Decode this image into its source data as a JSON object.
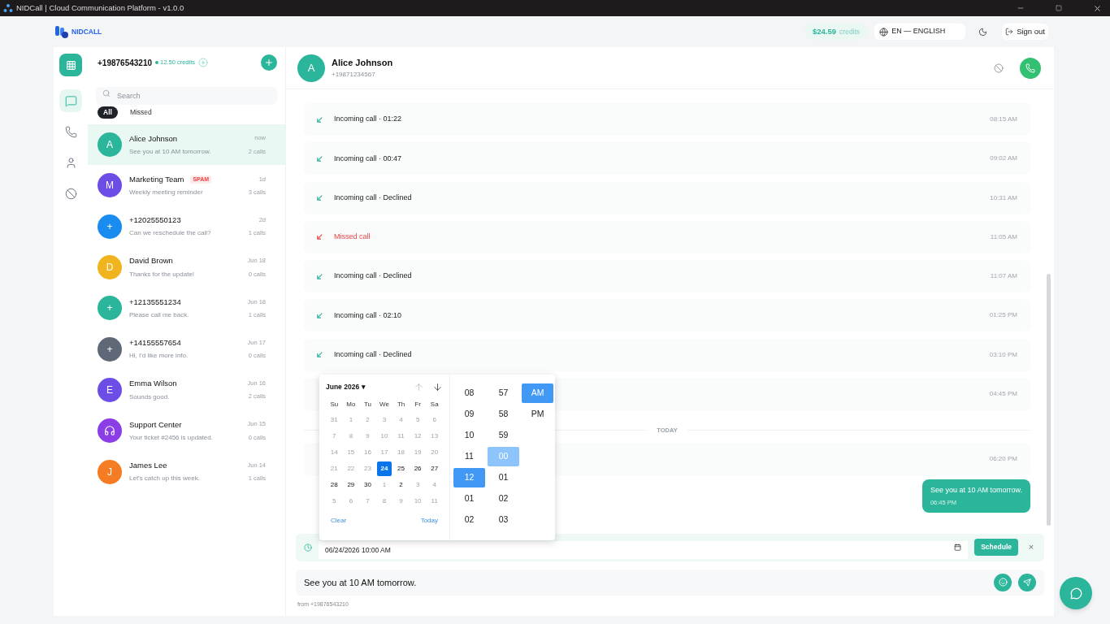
{
  "window": {
    "title": "NIDCall | Cloud Communication Platform - v1.0.0"
  },
  "header": {
    "logo": "NIDCALL",
    "balance": "$24.59",
    "balance_unit": "credits",
    "language": "EN — ENGLISH",
    "sign_out": "Sign out"
  },
  "rail": [
    {
      "kind": "chat",
      "selected": true
    },
    {
      "kind": "phone",
      "selected": false
    },
    {
      "kind": "person",
      "selected": false
    },
    {
      "kind": "block",
      "selected": false
    }
  ],
  "account": {
    "number": "+19876543210",
    "credits": "12.50 credits"
  },
  "search": {
    "placeholder": "Search"
  },
  "filters": [
    {
      "label": "All",
      "selected": true
    },
    {
      "label": "Missed",
      "selected": false
    }
  ],
  "contacts": [
    {
      "avatar": {
        "kind": "letter",
        "text": "A"
      },
      "color": "#2bb59a",
      "name": "Alice Johnson",
      "preview": "See you at 10 AM tomorrow.",
      "time": "now",
      "calls": "2 calls",
      "selected": true
    },
    {
      "avatar": {
        "kind": "letter",
        "text": "M"
      },
      "color": "#6c4ee6",
      "name": "Marketing Team",
      "tag": "SPAM",
      "preview": "Weekly meeting reminder",
      "time": "1d",
      "calls": "3 calls",
      "selected": false
    },
    {
      "avatar": {
        "kind": "letter",
        "text": "+"
      },
      "color": "#1a8cf0",
      "name": "+12025550123",
      "preview": "Can we reschedule the call?",
      "time": "2d",
      "calls": "1 calls",
      "selected": false
    },
    {
      "avatar": {
        "kind": "letter",
        "text": "D"
      },
      "color": "#f0b41e",
      "name": "David Brown",
      "preview": "Thanks for the update!",
      "time": "Jun 18",
      "calls": "0 calls",
      "selected": false
    },
    {
      "avatar": {
        "kind": "letter",
        "text": "+"
      },
      "color": "#2bb59a",
      "name": "+12135551234",
      "preview": "Please call me back.",
      "time": "Jun 18",
      "calls": "1 calls",
      "selected": false
    },
    {
      "avatar": {
        "kind": "letter",
        "text": "+"
      },
      "color": "#5f6877",
      "name": "+14155557654",
      "preview": "Hi, I'd like more info.",
      "time": "Jun 17",
      "calls": "0 calls",
      "selected": false
    },
    {
      "avatar": {
        "kind": "letter",
        "text": "E"
      },
      "color": "#6c4ee6",
      "name": "Emma Wilson",
      "preview": "Sounds good.",
      "time": "Jun 16",
      "calls": "2 calls",
      "selected": false
    },
    {
      "avatar": {
        "kind": "icon"
      },
      "color": "#8b3ee6",
      "name": "Support Center",
      "preview": "Your ticket #2456 is updated.",
      "time": "Jun 15",
      "calls": "0 calls",
      "selected": false
    },
    {
      "avatar": {
        "kind": "letter",
        "text": "J"
      },
      "color": "#f57c22",
      "name": "James Lee",
      "preview": "Let's catch up this week.",
      "time": "Jun 14",
      "calls": "1 calls",
      "selected": false
    }
  ],
  "chat": {
    "avatar": "A",
    "name": "Alice Johnson",
    "phone": "+19871234567",
    "log": [
      {
        "kind": "incoming",
        "label": "Incoming call · 01:22",
        "time": "08:15 AM"
      },
      {
        "kind": "incoming",
        "label": "Incoming call · 00:47",
        "time": "09:02 AM"
      },
      {
        "kind": "incoming",
        "label": "Incoming call · Declined",
        "time": "10:31 AM"
      },
      {
        "kind": "missed",
        "label": "Missed call",
        "time": "11:05 AM"
      },
      {
        "kind": "incoming",
        "label": "Incoming call · Declined",
        "time": "11:07 AM"
      },
      {
        "kind": "incoming",
        "label": "Incoming call · 02:10",
        "time": "01:25 PM"
      },
      {
        "kind": "incoming",
        "label": "Incoming call · Declined",
        "time": "03:10 PM"
      },
      {
        "kind": "covered",
        "time": "04:45 PM"
      },
      {
        "kind": "divider",
        "label": "TODAY"
      },
      {
        "kind": "covered",
        "time": "06:20 PM"
      },
      {
        "kind": "outgoing",
        "label": "See you at 10 AM tomorrow.",
        "time": "06:45 PM"
      }
    ],
    "schedule": {
      "value": "06/24/2026 10:00 AM",
      "button": "Schedule",
      "close": "×"
    },
    "composer": {
      "value": "See you at 10 AM tomorrow."
    },
    "from": "from +19876543210"
  },
  "picker": {
    "month": "June 2026",
    "month_caret": "▾",
    "weekdays": [
      "Su",
      "Mo",
      "Tu",
      "We",
      "Th",
      "Fr",
      "Sa"
    ],
    "weeks": [
      [
        {
          "d": "31",
          "disabled": true,
          "selected": false
        },
        {
          "d": "1",
          "disabled": true,
          "selected": false
        },
        {
          "d": "2",
          "disabled": true,
          "selected": false
        },
        {
          "d": "3",
          "disabled": true,
          "selected": false
        },
        {
          "d": "4",
          "disabled": true,
          "selected": false
        },
        {
          "d": "5",
          "disabled": true,
          "selected": false
        },
        {
          "d": "6",
          "disabled": true,
          "selected": false
        }
      ],
      [
        {
          "d": "7",
          "disabled": true,
          "selected": false
        },
        {
          "d": "8",
          "disabled": true,
          "selected": false
        },
        {
          "d": "9",
          "disabled": true,
          "selected": false
        },
        {
          "d": "10",
          "disabled": true,
          "selected": false
        },
        {
          "d": "11",
          "disabled": true,
          "selected": false
        },
        {
          "d": "12",
          "disabled": true,
          "selected": false
        },
        {
          "d": "13",
          "disabled": true,
          "selected": false
        }
      ],
      [
        {
          "d": "14",
          "disabled": true,
          "selected": false
        },
        {
          "d": "15",
          "disabled": true,
          "selected": false
        },
        {
          "d": "16",
          "disabled": true,
          "selected": false
        },
        {
          "d": "17",
          "disabled": true,
          "selected": false
        },
        {
          "d": "18",
          "disabled": true,
          "selected": false
        },
        {
          "d": "19",
          "disabled": true,
          "selected": false
        },
        {
          "d": "20",
          "disabled": true,
          "selected": false
        }
      ],
      [
        {
          "d": "21",
          "disabled": true,
          "selected": false
        },
        {
          "d": "22",
          "disabled": true,
          "selected": false
        },
        {
          "d": "23",
          "disabled": true,
          "selected": false
        },
        {
          "d": "24",
          "disabled": false,
          "selected": true
        },
        {
          "d": "25",
          "disabled": false,
          "selected": false
        },
        {
          "d": "26",
          "disabled": false,
          "selected": false
        },
        {
          "d": "27",
          "disabled": false,
          "selected": false
        }
      ],
      [
        {
          "d": "28",
          "disabled": false,
          "selected": false
        },
        {
          "d": "29",
          "disabled": false,
          "selected": false
        },
        {
          "d": "30",
          "disabled": false,
          "selected": false
        },
        {
          "d": "1",
          "disabled": true,
          "selected": false
        },
        {
          "d": "2",
          "disabled": false,
          "selected": false
        },
        {
          "d": "3",
          "disabled": true,
          "selected": false
        },
        {
          "d": "4",
          "disabled": true,
          "selected": false
        }
      ],
      [
        {
          "d": "5",
          "disabled": true,
          "selected": false
        },
        {
          "d": "6",
          "disabled": true,
          "selected": false
        },
        {
          "d": "7",
          "disabled": true,
          "selected": false
        },
        {
          "d": "8",
          "disabled": true,
          "selected": false
        },
        {
          "d": "9",
          "disabled": true,
          "selected": false
        },
        {
          "d": "10",
          "disabled": true,
          "selected": false
        },
        {
          "d": "11",
          "disabled": true,
          "selected": false
        }
      ]
    ],
    "clear": "Clear",
    "today": "Today",
    "hours": [
      {
        "v": "08",
        "selected": false
      },
      {
        "v": "09",
        "selected": false
      },
      {
        "v": "10",
        "selected": false
      },
      {
        "v": "11",
        "selected": false
      },
      {
        "v": "12",
        "selected": true
      },
      {
        "v": "01",
        "selected": false
      },
      {
        "v": "02",
        "selected": false
      }
    ],
    "minutes": [
      {
        "v": "57",
        "selected": false
      },
      {
        "v": "58",
        "selected": false
      },
      {
        "v": "59",
        "selected": false
      },
      {
        "v": "00",
        "selected": true
      },
      {
        "v": "01",
        "selected": false
      },
      {
        "v": "02",
        "selected": false
      },
      {
        "v": "03",
        "selected": false
      }
    ],
    "periods": [
      {
        "v": "AM",
        "selected": true
      },
      {
        "v": "PM",
        "selected": false
      }
    ]
  }
}
